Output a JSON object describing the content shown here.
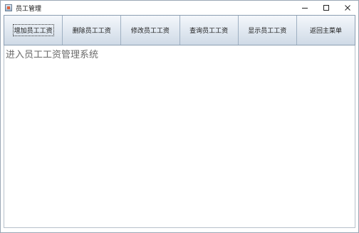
{
  "window": {
    "title": "员工管理",
    "icon": "java-app-icon",
    "controls": {
      "minimize": "minimize-icon",
      "maximize": "maximize-icon",
      "close": "close-icon"
    }
  },
  "toolbar": {
    "buttons": [
      {
        "label": "增加员工工资"
      },
      {
        "label": "删除员工工资"
      },
      {
        "label": "修改员工工资"
      },
      {
        "label": "查询员工工资"
      },
      {
        "label": "显示员工工资"
      },
      {
        "label": "返回主菜单"
      }
    ]
  },
  "main": {
    "message": "进入员工工资管理系统"
  }
}
